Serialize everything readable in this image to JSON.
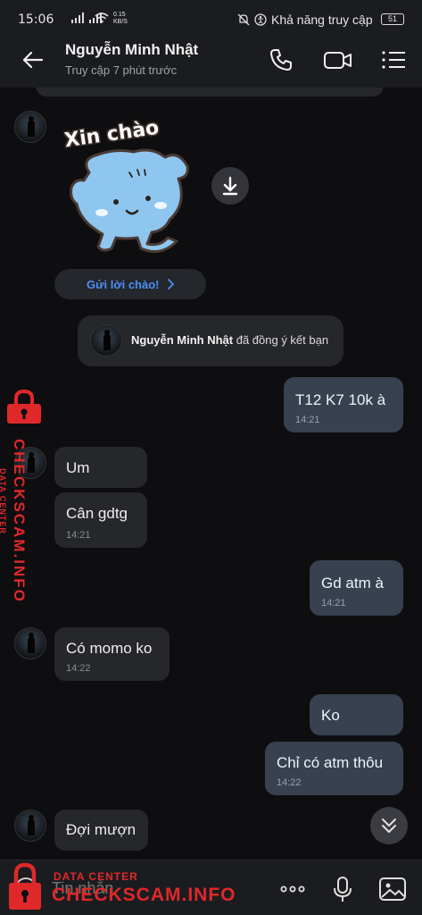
{
  "status_bar": {
    "time": "15:06",
    "signals": "▕▗▙ ▕▗▙",
    "network_speed_value": "0.15",
    "network_speed_unit": "KB/S",
    "accessibility_text": "Khả năng truy cập",
    "battery": "51"
  },
  "header": {
    "contact_name": "Nguyễn Minh Nhật",
    "last_seen": "Truy cập 7 phút trước"
  },
  "sticker": {
    "text": "Xin chào"
  },
  "greeting_button": {
    "label": "Gửi lời chào!"
  },
  "system_note": {
    "name": "Nguyễn Minh Nhật",
    "text": " đã đồng ý kết bạn"
  },
  "messages": [
    {
      "direction": "out",
      "text": "T12 K7 10k à",
      "time": "14:21"
    },
    {
      "direction": "in",
      "text": "Um",
      "time": ""
    },
    {
      "direction": "in",
      "text": "Cân gdtg",
      "time": "14:21"
    },
    {
      "direction": "out",
      "text": "Gd atm à",
      "time": "14:21"
    },
    {
      "direction": "in",
      "text": "Có momo ko",
      "time": "14:22"
    },
    {
      "direction": "out",
      "text": "Ko",
      "time": ""
    },
    {
      "direction": "out",
      "text": "Chỉ có atm thôu",
      "time": "14:22"
    },
    {
      "direction": "in",
      "text": "Đợi mượn",
      "time": ""
    }
  ],
  "composer": {
    "placeholder": "Tin nhắn"
  },
  "watermark": {
    "line1": "DATA CENTER",
    "line2": "CHECKSCAM.INFO"
  },
  "colors": {
    "background": "#0e0e10",
    "incoming_bubble": "#26272b",
    "outgoing_bubble": "#374150",
    "accent": "#4c8ff7",
    "watermark": "#e0282a"
  }
}
